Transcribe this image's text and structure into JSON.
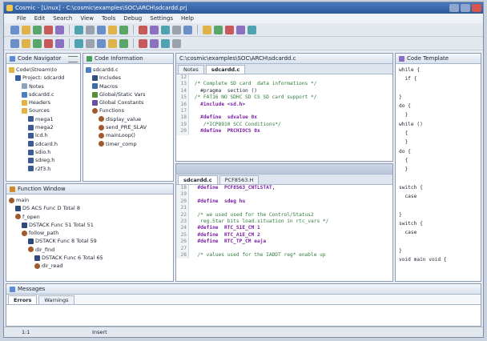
{
  "window": {
    "title": "Cosmic - [Linux] - C:\\cosmic\\examples\\SOC\\ARCH\\sdcardd.prj",
    "buttons": [
      "minimize",
      "maximize",
      "close"
    ]
  },
  "menu": [
    "File",
    "Edit",
    "Search",
    "View",
    "Tools",
    "Debug",
    "Settings",
    "Help"
  ],
  "toolbar1_icons": [
    "new-file-icon",
    "open-icon",
    "save-icon",
    "save-all-icon",
    "cut-icon",
    "copy-icon",
    "paste-icon",
    "undo-icon",
    "redo-icon",
    "find-icon",
    "build-icon",
    "rebuild-icon",
    "stop-icon",
    "compile-icon",
    "link-icon",
    "debug-icon",
    "run-icon",
    "breakpoint-icon",
    "settings-icon",
    "help-icon"
  ],
  "toolbar2_icons": [
    "back-icon",
    "forward-icon",
    "home-icon",
    "bookmark-icon",
    "step-into-icon",
    "step-over-icon",
    "step-out-icon",
    "reset-icon",
    "halt-icon",
    "watch-icon",
    "memory-icon",
    "register-icon",
    "trace-icon",
    "profile-icon"
  ],
  "code_navigator": {
    "title": "Code Navigator",
    "items": [
      {
        "label": "Code\\Stream\\to",
        "indent": 0,
        "icon": "folder-icon"
      },
      {
        "label": "Project: sdcardd",
        "indent": 1,
        "icon": "project-icon"
      },
      {
        "label": "Notes",
        "indent": 2,
        "icon": "notes-icon"
      },
      {
        "label": "sdcardd.c",
        "indent": 2,
        "icon": "c-file-icon"
      },
      {
        "label": "Headers",
        "indent": 2,
        "icon": "folder-icon"
      },
      {
        "label": "Sources",
        "indent": 2,
        "icon": "folder-icon"
      },
      {
        "label": "mega1",
        "indent": 3,
        "icon": "file-icon"
      },
      {
        "label": "mega2",
        "indent": 3,
        "icon": "file-icon"
      },
      {
        "label": "lcd.h",
        "indent": 3,
        "icon": "file-icon"
      },
      {
        "label": "sdcard.h",
        "indent": 3,
        "icon": "file-icon"
      },
      {
        "label": "sdio.h",
        "indent": 3,
        "icon": "file-icon"
      },
      {
        "label": "sdreg.h",
        "indent": 3,
        "icon": "file-icon"
      },
      {
        "label": "r2f3.h",
        "indent": 3,
        "icon": "file-icon"
      }
    ]
  },
  "code_information": {
    "title": "Code Information",
    "items": [
      {
        "label": "sdcardd.c",
        "indent": 0,
        "icon": "c-file-icon"
      },
      {
        "label": "Includes",
        "indent": 1,
        "icon": "include-icon"
      },
      {
        "label": "Macros",
        "indent": 1,
        "icon": "macro-icon"
      },
      {
        "label": "Global/Static Vars",
        "indent": 1,
        "icon": "variable-icon"
      },
      {
        "label": "Global Constants",
        "indent": 1,
        "icon": "constant-icon"
      },
      {
        "label": "Functions",
        "indent": 1,
        "icon": "function-icon"
      },
      {
        "label": "display_value",
        "indent": 2,
        "icon": "function-icon"
      },
      {
        "label": "send_PRE_SLAV",
        "indent": 2,
        "icon": "function-icon"
      },
      {
        "label": "mainLoop()",
        "indent": 2,
        "icon": "function-icon"
      },
      {
        "label": "timer_comp",
        "indent": 2,
        "icon": "function-icon"
      }
    ]
  },
  "editor_top": {
    "title": "C:\\cosmic\\examples\\SOC\\ARCH\\sdcardd.c",
    "tabs": [
      {
        "label": "Notes",
        "active": false
      },
      {
        "label": "sdcardd.c",
        "active": true
      }
    ],
    "lines": [
      {
        "n": "12",
        "t": "",
        "k": "def"
      },
      {
        "n": "13",
        "t": " /* Complete SD card  data informations */",
        "k": "com"
      },
      {
        "n": "14",
        "t": "   #pragma  section ()",
        "k": "def"
      },
      {
        "n": "15",
        "t": " /* FAT16 NO SDHC SD CS SD card support */",
        "k": "com"
      },
      {
        "n": "16",
        "t": "   #include <sd.h>",
        "k": "kw"
      },
      {
        "n": "17",
        "t": "",
        "k": "def"
      },
      {
        "n": "18",
        "t": "   #define  sdvalue 0x",
        "k": "kw"
      },
      {
        "n": "19",
        "t": "    /*ICP8910 SCC Conditions*/",
        "k": "com"
      },
      {
        "n": "20",
        "t": "   #define  PRCHIOCS 0x",
        "k": "kw"
      }
    ]
  },
  "editor_bottom": {
    "tabs": [
      {
        "label": "sdcardd.c",
        "active": true
      },
      {
        "label": "PCF8563.H",
        "active": false
      }
    ],
    "lines": [
      {
        "n": "18",
        "t": "  #define  PCF8563_CNTLSTAT,",
        "k": "kw"
      },
      {
        "n": "19",
        "t": "",
        "k": "def"
      },
      {
        "n": "20",
        "t": "  #define  sdeg hu",
        "k": "kw"
      },
      {
        "n": "21",
        "t": "",
        "k": "def"
      },
      {
        "n": "22",
        "t": "  /* we used used for the Control/Status2",
        "k": "com"
      },
      {
        "n": "23",
        "t": "   reg.Star bits load.situation in rtc_vars */",
        "k": "com"
      },
      {
        "n": "24",
        "t": "  #define  RTC_S1E_CM 1",
        "k": "kw"
      },
      {
        "n": "25",
        "t": "  #define  RTC_A1E_CM 2",
        "k": "kw"
      },
      {
        "n": "26",
        "t": "  #define  RTC_TP_CM eaja",
        "k": "kw"
      },
      {
        "n": "27",
        "t": "",
        "k": "def"
      },
      {
        "n": "28",
        "t": "  /* values used for the IADDT reg* enable up",
        "k": "com"
      }
    ]
  },
  "functions_panel": {
    "title": "Function Window",
    "items": [
      {
        "label": "main",
        "indent": 0,
        "icon": "function-icon"
      },
      {
        "label": "DS ACS Func  D Total 8",
        "indent": 1,
        "icon": "stack-icon"
      },
      {
        "label": "f_open",
        "indent": 1,
        "icon": "function-icon"
      },
      {
        "label": "DSTACK Func  51 Total 51",
        "indent": 2,
        "icon": "stack-icon"
      },
      {
        "label": "follow_path",
        "indent": 2,
        "icon": "function-icon"
      },
      {
        "label": "DSTACK Func  8 Total 59",
        "indent": 3,
        "icon": "stack-icon"
      },
      {
        "label": "dir_find",
        "indent": 3,
        "icon": "function-icon"
      },
      {
        "label": "DSTACK Func  6 Total 65",
        "indent": 4,
        "icon": "stack-icon"
      },
      {
        "label": "dir_read",
        "indent": 4,
        "icon": "function-icon"
      }
    ]
  },
  "code_template": {
    "title": "Code Template",
    "lines": [
      "while {",
      "  if {",
      "",
      "}",
      "do {",
      "  }",
      "while ()",
      "  {",
      "  }",
      "do {",
      "  {",
      "  }",
      "",
      "switch {",
      "  case",
      "",
      "}",
      "switch {",
      "  case",
      "",
      "}",
      "void main void {"
    ]
  },
  "messages": {
    "title": "Messages",
    "tabs": [
      {
        "label": "Errors",
        "active": true
      },
      {
        "label": "Warnings",
        "active": false
      }
    ]
  },
  "statusbar": {
    "position": "1:1",
    "mode": "Insert"
  },
  "colors": {
    "titlebar": "#3566a8",
    "panel_border": "#8f9db3",
    "comment": "#2f7a3a",
    "keyword": "#7a1fa2"
  }
}
